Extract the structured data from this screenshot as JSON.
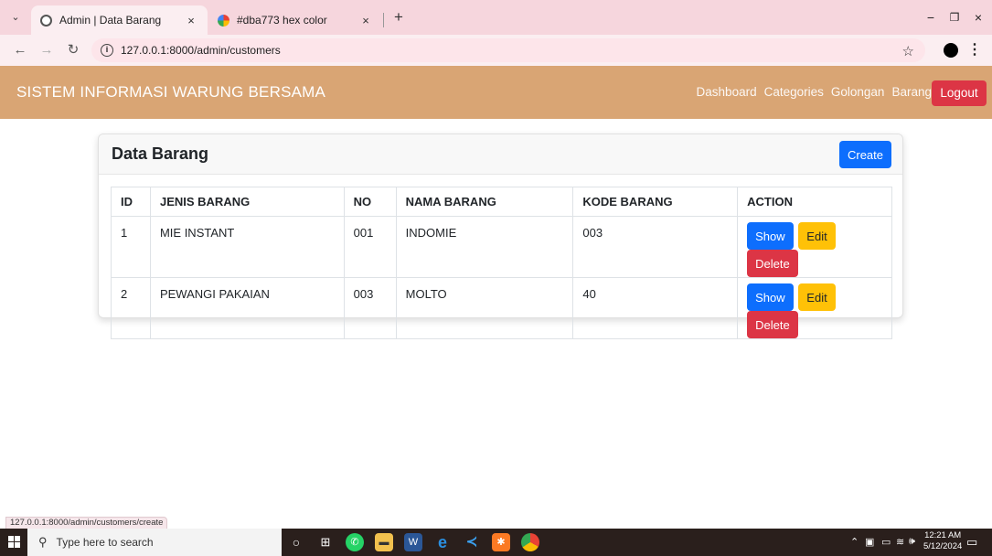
{
  "browser": {
    "tabs": [
      {
        "title": "Admin | Data Barang",
        "close": "×"
      },
      {
        "title": "#dba773 hex color",
        "close": "×"
      }
    ],
    "new_tab": "+",
    "url": "127.0.0.1:8000/admin/customers",
    "window_controls": {
      "minimize": "−",
      "maximize": "❐",
      "close": "×"
    }
  },
  "navbar": {
    "brand": "SISTEM INFORMASI WARUNG BERSAMA",
    "links": [
      "Dashboard",
      "Categories",
      "Golongan",
      "Barang"
    ],
    "logout": "Logout",
    "color": "#d9a574"
  },
  "card": {
    "title": "Data Barang",
    "create_label": "Create"
  },
  "table": {
    "headers": [
      "ID",
      "JENIS BARANG",
      "NO",
      "NAMA BARANG",
      "KODE BARANG",
      "ACTION"
    ],
    "rows": [
      {
        "id": "1",
        "jenis": "MIE INSTANT",
        "no": "001",
        "nama": "INDOMIE",
        "kode": "003"
      },
      {
        "id": "2",
        "jenis": "PEWANGI PAKAIAN",
        "no": "003",
        "nama": "MOLTO",
        "kode": "40"
      }
    ],
    "actions": {
      "show": "Show",
      "edit": "Edit",
      "delete": "Delete"
    }
  },
  "status_url": "127.0.0.1:8000/admin/customers/create",
  "taskbar": {
    "search_placeholder": "Type here to search",
    "time": "12:21 AM",
    "date": "5/12/2024"
  }
}
